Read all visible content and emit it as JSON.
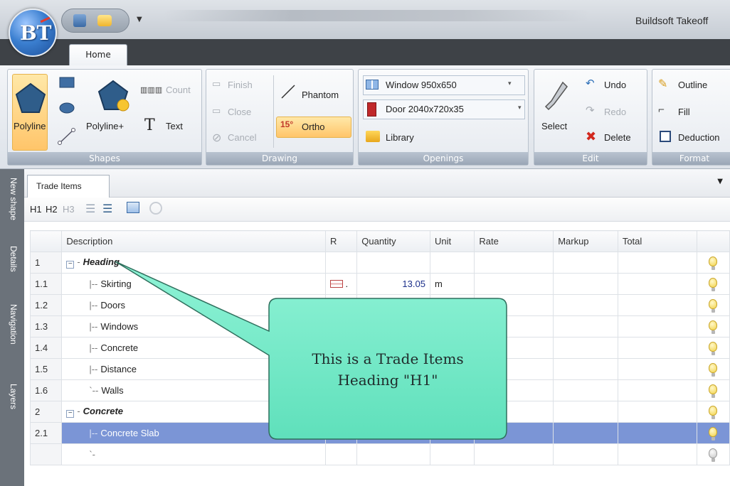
{
  "app": {
    "title": "Buildsoft Takeoff"
  },
  "ribbon": {
    "tab_home": "Home",
    "shapes": {
      "label": "Shapes",
      "polyline": "Polyline",
      "polyline_plus": "Polyline+",
      "count": "Count",
      "text": "Text"
    },
    "drawing": {
      "label": "Drawing",
      "finish": "Finish",
      "close": "Close",
      "cancel": "Cancel",
      "phantom": "Phantom",
      "ortho": "Ortho"
    },
    "openings": {
      "label": "Openings",
      "window": "Window 950x650",
      "door": "Door 2040x720x35",
      "library": "Library"
    },
    "edit": {
      "label": "Edit",
      "select": "Select",
      "undo": "Undo",
      "redo": "Redo",
      "delete": "Delete"
    },
    "format": {
      "label": "Format",
      "outline": "Outline",
      "fill": "Fill",
      "deduction": "Deduction"
    }
  },
  "sidebar": {
    "tabs": [
      "New shape",
      "Details",
      "Navigation",
      "Layers"
    ]
  },
  "panel": {
    "tab": "Trade Items"
  },
  "toolbar": {
    "h1": "H1",
    "h2": "H2",
    "h3": "H3"
  },
  "grid": {
    "columns": [
      "Description",
      "R",
      "Quantity",
      "Unit",
      "Rate",
      "Markup",
      "Total"
    ],
    "rows": [
      {
        "num": "1",
        "desc": "Heading",
        "qty": "",
        "unit": ""
      },
      {
        "num": "1.1",
        "desc": "Skirting",
        "qty": "13.05",
        "unit": "m"
      },
      {
        "num": "1.2",
        "desc": "Doors",
        "qty": "",
        "unit": ""
      },
      {
        "num": "1.3",
        "desc": "Windows",
        "qty": "",
        "unit": ""
      },
      {
        "num": "1.4",
        "desc": "Concrete",
        "qty": "",
        "unit": ""
      },
      {
        "num": "1.5",
        "desc": "Distance",
        "qty": "",
        "unit": ""
      },
      {
        "num": "1.6",
        "desc": "Walls",
        "qty": "",
        "unit": ""
      },
      {
        "num": "2",
        "desc": "Concrete",
        "qty": "",
        "unit": ""
      },
      {
        "num": "2.1",
        "desc": "Concrete Slab",
        "qty": "",
        "unit": ""
      }
    ]
  },
  "callout": {
    "line1": "This is a Trade Items",
    "line2": "Heading \"H1\""
  },
  "colors": {
    "selection": "#7b95d6",
    "callout_fill": "#78ebc8",
    "ribbon_dark": "#3e4247"
  }
}
